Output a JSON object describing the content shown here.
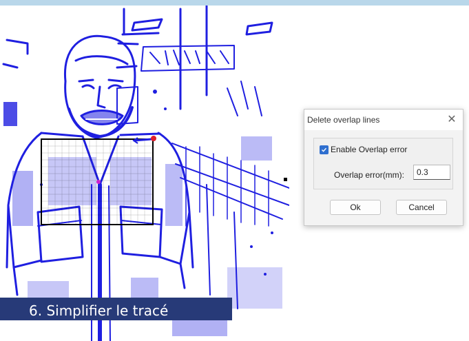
{
  "dialog": {
    "title": "Delete overlap lines",
    "close_icon": "close-icon",
    "checkbox": {
      "label": "Enable Overlap error",
      "checked": true
    },
    "overlap_field": {
      "label": "Overlap error(mm):",
      "value": "0.3"
    },
    "ok_label": "Ok",
    "cancel_label": "Cancel"
  },
  "caption": "6. Simplifier le tracé",
  "colors": {
    "trace": "#1f1fe0",
    "caption_bg": "#273a78",
    "frame_strip": "#b9d7ea",
    "accent": "#2f6fcf"
  },
  "canvas": {
    "content": "traced-photo",
    "selection_handles": [
      "red",
      "magenta",
      "black"
    ]
  }
}
